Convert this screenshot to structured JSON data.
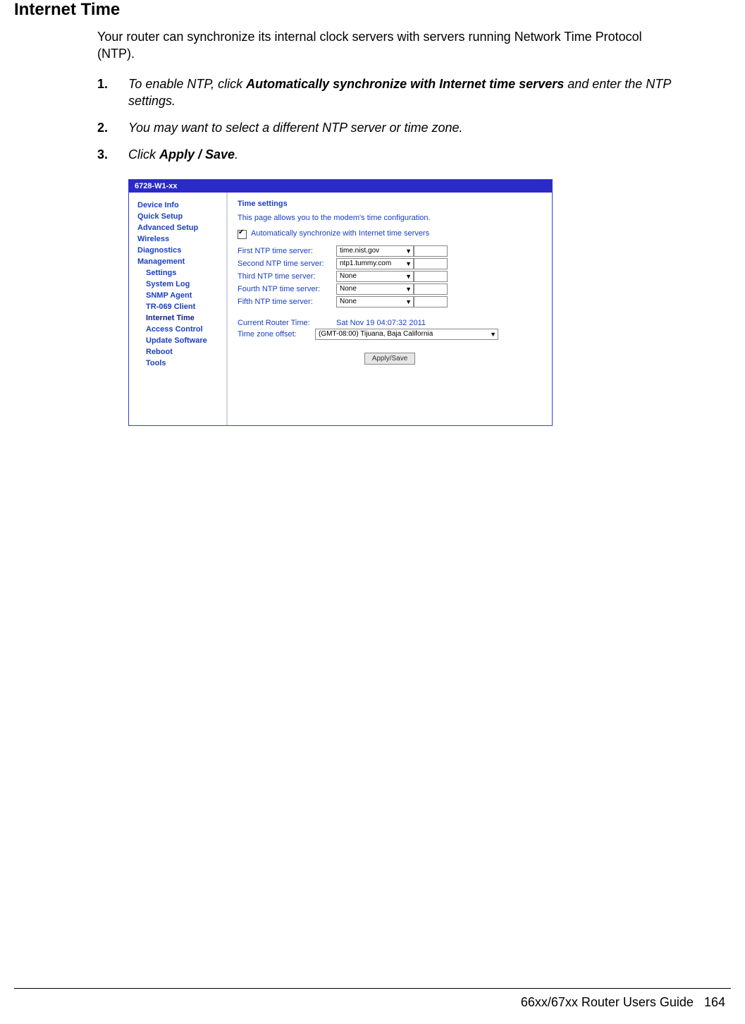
{
  "heading": "Internet Time",
  "intro": "Your router can synchronize its internal clock servers with servers running Network Time Protocol (NTP).",
  "steps": [
    {
      "num": "1.",
      "pre": "To enable NTP, click ",
      "bold": "Automatically synchronize with Internet time servers",
      "post": " and enter the NTP settings."
    },
    {
      "num": "2.",
      "pre": "You may want to select a different NTP server or time zone.",
      "bold": "",
      "post": ""
    },
    {
      "num": "3.",
      "pre": "Click ",
      "bold": "Apply / Save",
      "post": "."
    }
  ],
  "router": {
    "titlebar": "6728-W1-xx",
    "sidebar": {
      "top": [
        "Device Info",
        "Quick Setup",
        "Advanced Setup",
        "Wireless",
        "Diagnostics",
        "Management"
      ],
      "sub": [
        "Settings",
        "System Log",
        "SNMP Agent",
        "TR-069 Client",
        "Internet Time",
        "Access Control",
        "Update Software",
        "Reboot",
        "Tools"
      ],
      "active": "Internet Time"
    },
    "main": {
      "title": "Time settings",
      "desc": "This page allows you to the modem's time configuration.",
      "checkbox_label": "Automatically synchronize with Internet time servers",
      "ntp": [
        {
          "label": "First NTP time server:",
          "value": "time.nist.gov"
        },
        {
          "label": "Second NTP time server:",
          "value": "ntp1.tummy.com"
        },
        {
          "label": "Third NTP time server:",
          "value": "None"
        },
        {
          "label": "Fourth NTP time server:",
          "value": "None"
        },
        {
          "label": "Fifth NTP time server:",
          "value": "None"
        }
      ],
      "current_time_label": "Current Router Time:",
      "current_time_value": "Sat Nov 19 04:07:32 2011",
      "tz_label": "Time zone offset:",
      "tz_value": "(GMT-08:00) Tijuana, Baja California",
      "apply_button": "Apply/Save"
    }
  },
  "footer": {
    "guide": "66xx/67xx Router Users Guide",
    "page": "164"
  }
}
